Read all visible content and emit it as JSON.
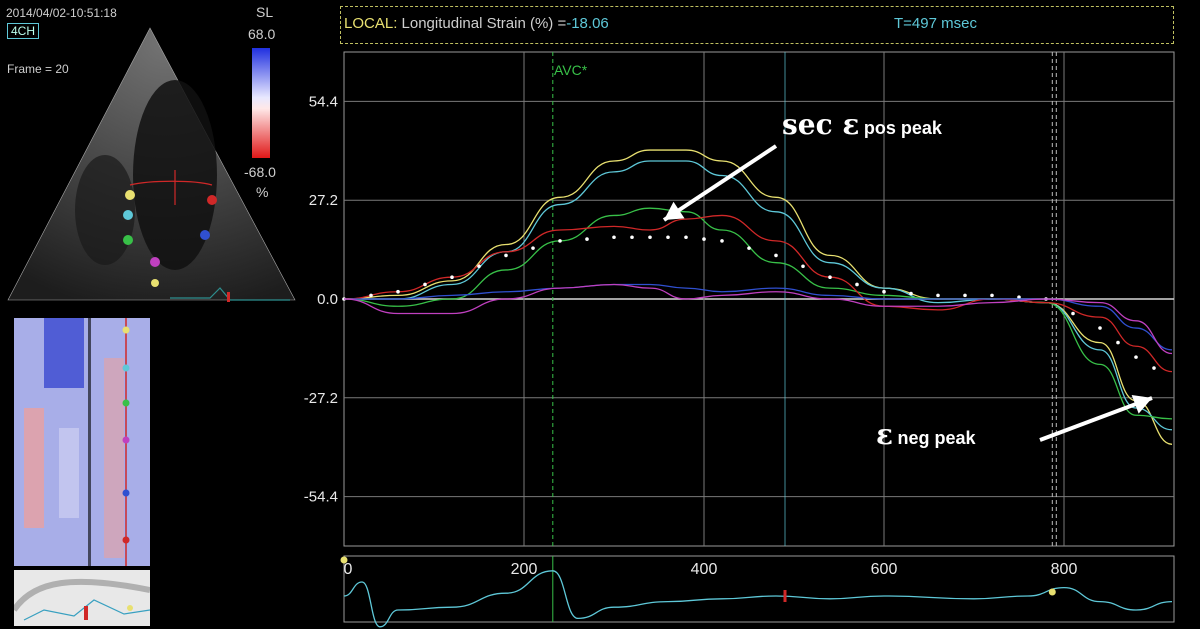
{
  "echo": {
    "timestamp": "2014/04/02-10:51:18",
    "view": "4CH",
    "frame": "Frame = 20",
    "scale_label": "SL",
    "scale_max": "68.0",
    "scale_min": "-68.0",
    "scale_unit": "%"
  },
  "header": {
    "local_label": "LOCAL:",
    "metric": "Longitudinal Strain (%) =",
    "value": "-18.06",
    "time": "T=497 msec"
  },
  "event_label": "AVC*",
  "annotations": {
    "pos_main": "sec ε",
    "pos_sub": "pos peak",
    "neg_main": "ε",
    "neg_sub": "neg peak"
  },
  "colors": {
    "yellow": "#e8e070",
    "cyan": "#5ec8d8",
    "green": "#38c048",
    "magenta": "#c040c0",
    "blue": "#3050d0",
    "red": "#d02828",
    "white": "#ffffff",
    "purple": "#7a3cd0"
  },
  "chart_data": {
    "type": "line",
    "xlabel": "",
    "ylabel": "",
    "x_ticks": [
      0,
      200,
      400,
      600,
      800
    ],
    "y_ticks": [
      54.4,
      27.2,
      0.0,
      -27.2,
      -54.4
    ],
    "y_tick_labels": [
      "54.4",
      "27.2",
      "0.0",
      "-27.2",
      "-54.4"
    ],
    "x_tick_labels": [
      "0",
      "200",
      "400",
      "600",
      "800"
    ],
    "xlim": [
      0,
      920
    ],
    "ylim": [
      -68,
      68
    ],
    "grid": true,
    "avc_x": 232,
    "cursor_x": 490,
    "end_x": 787,
    "series": [
      {
        "color": "yellow",
        "x": [
          0,
          60,
          120,
          180,
          240,
          300,
          340,
          380,
          420,
          480,
          540,
          600,
          660,
          720,
          780,
          840,
          880,
          920
        ],
        "y": [
          0,
          1,
          5,
          15,
          28,
          38,
          41,
          41,
          38,
          28,
          12,
          3,
          0,
          0,
          -1,
          -12,
          -28,
          -40
        ]
      },
      {
        "color": "cyan",
        "x": [
          0,
          60,
          120,
          180,
          240,
          300,
          340,
          380,
          420,
          480,
          540,
          600,
          660,
          720,
          780,
          840,
          880,
          920
        ],
        "y": [
          0,
          0,
          4,
          13,
          26,
          35,
          38,
          38,
          34,
          24,
          10,
          3,
          -1,
          0,
          -1,
          -14,
          -30,
          -36
        ]
      },
      {
        "color": "green",
        "x": [
          0,
          60,
          120,
          180,
          240,
          300,
          340,
          380,
          420,
          480,
          540,
          600,
          660,
          720,
          780,
          840,
          880,
          920
        ],
        "y": [
          0,
          -2,
          0,
          8,
          16,
          23,
          25,
          24,
          19,
          10,
          3,
          1,
          0,
          0,
          -1,
          -18,
          -32,
          -33
        ]
      },
      {
        "color": "red",
        "x": [
          0,
          60,
          120,
          180,
          240,
          300,
          340,
          380,
          420,
          480,
          540,
          600,
          660,
          720,
          780,
          840,
          880,
          920
        ],
        "y": [
          0,
          2,
          6,
          13,
          19,
          20,
          19,
          22,
          23,
          16,
          6,
          -2,
          -3,
          0,
          -1,
          -5,
          -13,
          -20
        ]
      },
      {
        "color": "white",
        "x": [
          0,
          60,
          120,
          180,
          240,
          300,
          340,
          380,
          420,
          480,
          540,
          600,
          660,
          720,
          780,
          840,
          880,
          920
        ],
        "y": [
          0,
          2,
          6,
          12,
          16,
          17,
          17,
          17,
          16,
          12,
          6,
          2,
          1,
          1,
          0,
          -8,
          -16,
          -22
        ]
      },
      {
        "color": "blue",
        "x": [
          0,
          60,
          120,
          180,
          240,
          300,
          340,
          380,
          420,
          480,
          540,
          600,
          660,
          720,
          780,
          840,
          880,
          920
        ],
        "y": [
          0,
          0,
          1,
          2,
          3,
          4,
          4,
          3,
          2,
          3,
          1,
          0,
          0,
          0,
          0,
          -2,
          -8,
          -14
        ]
      },
      {
        "color": "magenta",
        "x": [
          0,
          60,
          120,
          180,
          240,
          300,
          340,
          380,
          420,
          480,
          540,
          600,
          660,
          720,
          780,
          840,
          880,
          920
        ],
        "y": [
          0,
          -4,
          -4,
          0,
          3,
          4,
          3,
          0,
          1,
          2,
          0,
          -2,
          -2,
          -1,
          0,
          -1,
          -6,
          -15
        ]
      }
    ],
    "ecg_x_ticks": [
      "200",
      "400",
      "600",
      "800"
    ]
  }
}
